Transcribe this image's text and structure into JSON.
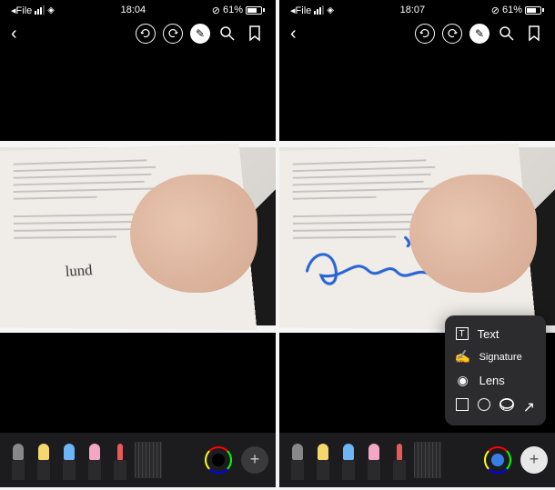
{
  "left": {
    "status": {
      "back_app": "File",
      "time": "18:04",
      "battery_pct": "61%"
    },
    "signature_text": "lund"
  },
  "right": {
    "status": {
      "back_app": "File",
      "time": "18:07",
      "battery_pct": "61%"
    },
    "signature_text": "Cirilo"
  },
  "popup": {
    "text_label": "Text",
    "signature_label": "Signature",
    "lens_label": "Lens"
  },
  "icons": {
    "back": "‹",
    "undo": "↺",
    "redo": "↻",
    "pen": "✎",
    "search": "⚲",
    "bookmark": "⚑",
    "add": "+",
    "text_box": "T",
    "sig": "~",
    "lens": "◉",
    "arrow": "↗"
  }
}
